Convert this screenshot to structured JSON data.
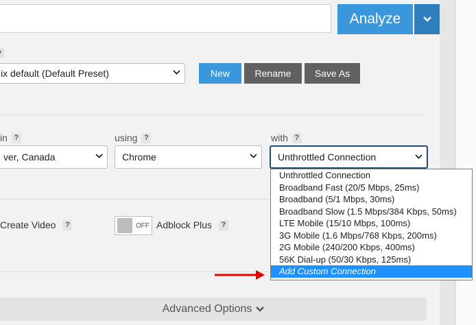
{
  "analyze": {
    "label": "Analyze",
    "caret_icon": "chevron-down-icon"
  },
  "preset": {
    "help": "?",
    "value": "ix default (Default Preset)"
  },
  "buttons": {
    "new": "New",
    "rename": "Rename",
    "save_as": "Save As"
  },
  "location": {
    "label": "in",
    "help": "?",
    "value": "ver, Canada"
  },
  "browser": {
    "label": "using",
    "help": "?",
    "value": "Chrome"
  },
  "connection": {
    "label": "with",
    "help": "?",
    "value": "Unthrottled Connection",
    "options": [
      "Unthrottled Connection",
      "Broadband Fast (20/5 Mbps, 25ms)",
      "Broadband (5/1 Mbps, 30ms)",
      "Broadband Slow (1.5 Mbps/384 Kbps, 50ms)",
      "LTE Mobile (15/10 Mbps, 100ms)",
      "3G Mobile (1.6 Mbps/768 Kbps, 200ms)",
      "2G Mobile (240/200 Kbps, 400ms)",
      "56K Dial-up (50/30 Kbps, 125ms)",
      "Add Custom Connection"
    ],
    "highlighted": "Add Custom Connection"
  },
  "options": {
    "create_video": {
      "label": "Create Video",
      "help": "?"
    },
    "adblock": {
      "label": "Adblock Plus",
      "help": "?",
      "toggle_state": "OFF"
    }
  },
  "advanced": {
    "label": "Advanced Options"
  },
  "colors": {
    "accent": "#3a97dc",
    "dark_button": "#616161",
    "highlight": "#1e90ff",
    "arrow": "#e00000"
  }
}
